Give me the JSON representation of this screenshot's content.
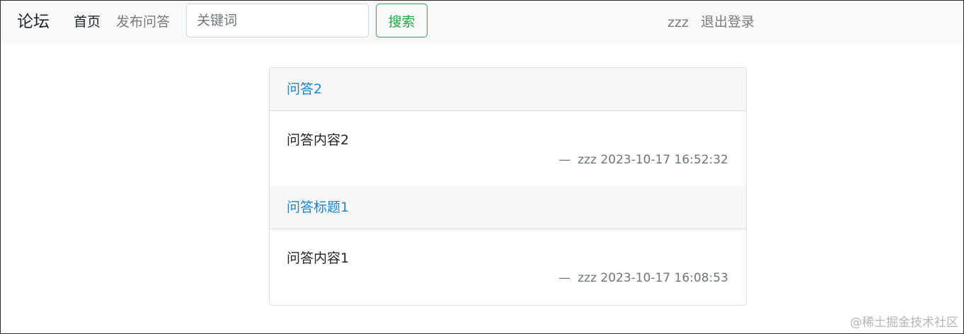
{
  "navbar": {
    "brand": "论坛",
    "home_label": "首页",
    "publish_label": "发布问答",
    "search_placeholder": "关键词",
    "search_button_label": "搜索",
    "username": "zzz",
    "logout_label": "退出登录"
  },
  "posts": [
    {
      "title": "问答2",
      "content": "问答内容2",
      "dash": "—",
      "author": "zzz",
      "timestamp": "2023-10-17 16:52:32"
    },
    {
      "title": "问答标题1",
      "content": "问答内容1",
      "dash": "—",
      "author": "zzz",
      "timestamp": "2023-10-17 16:08:53"
    }
  ],
  "watermark": "@稀土掘金技术社区",
  "colors": {
    "navbar_bg": "#f8f9fa",
    "title_link": "#1a85d1",
    "search_button": "#28a745",
    "muted_text": "#6c757d"
  }
}
